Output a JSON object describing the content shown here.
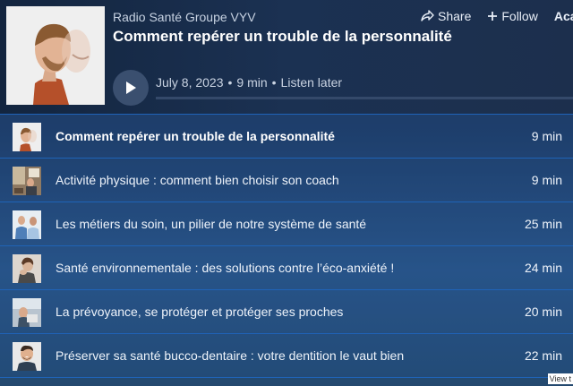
{
  "player": {
    "creator": "Radio Santé Groupe VYV",
    "title": "Comment repérer un trouble de la personnalité",
    "date": "July 8, 2023",
    "duration": "9 min",
    "listen_later": "Listen later",
    "separator": "•",
    "share_label": "Share",
    "follow_label": "Follow",
    "third_action_label": "Aca",
    "progress": 0
  },
  "episodes": [
    {
      "title": "Comment repérer un trouble de la personnalité",
      "duration": "9 min",
      "thumb": "man-profile",
      "active": true
    },
    {
      "title": "Activité physique : comment bien choisir son coach",
      "duration": "9 min",
      "thumb": "coach-room"
    },
    {
      "title": "Les métiers du soin, un pilier de notre système de santé",
      "duration": "25 min",
      "thumb": "nurses"
    },
    {
      "title": "Santé environnementale : des solutions contre l’éco-anxiété !",
      "duration": "24 min",
      "thumb": "woman-hand"
    },
    {
      "title": "La prévoyance, se protéger et protéger ses proches",
      "duration": "20 min",
      "thumb": "family"
    },
    {
      "title": "Préserver sa santé bucco-dentaire : votre dentition le vaut bien",
      "duration": "22 min",
      "thumb": "smiling-man"
    }
  ],
  "footer_badge": "View t",
  "icons": {
    "share": "share-icon",
    "follow": "plus-icon",
    "play": "play-icon"
  }
}
